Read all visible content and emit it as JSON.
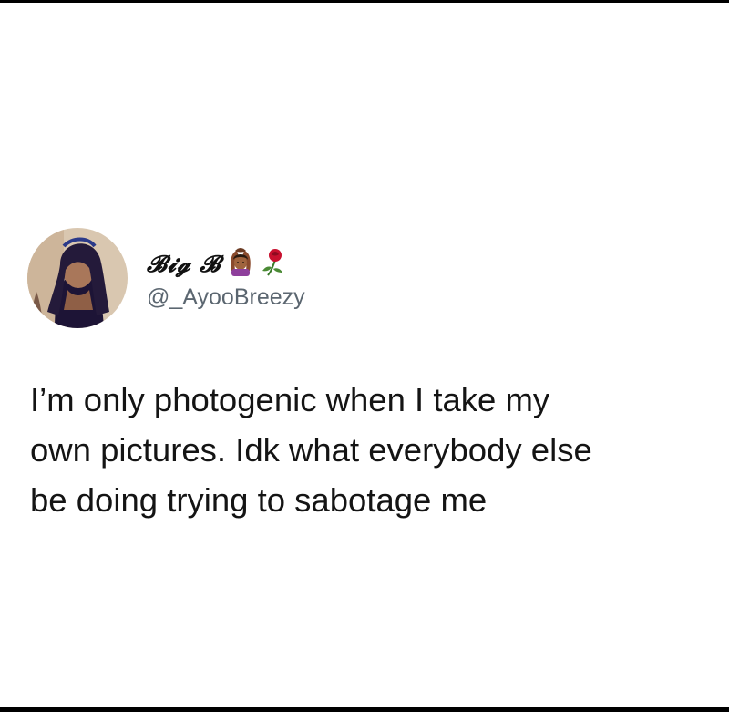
{
  "tweet": {
    "author": {
      "display_name": "𝓑𝓲𝓰 𝓑",
      "handle": "@_AyooBreezy",
      "emojis": [
        "woman-gesturing-ok-icon",
        "rose-icon"
      ]
    },
    "text": "I’m only photogenic when I take my\nown pictures. Idk what everybody else\nbe doing trying to sabotage me"
  },
  "colors": {
    "background": "#ffffff",
    "frame": "#000000",
    "text": "#141414",
    "handle": "#5b6670"
  }
}
